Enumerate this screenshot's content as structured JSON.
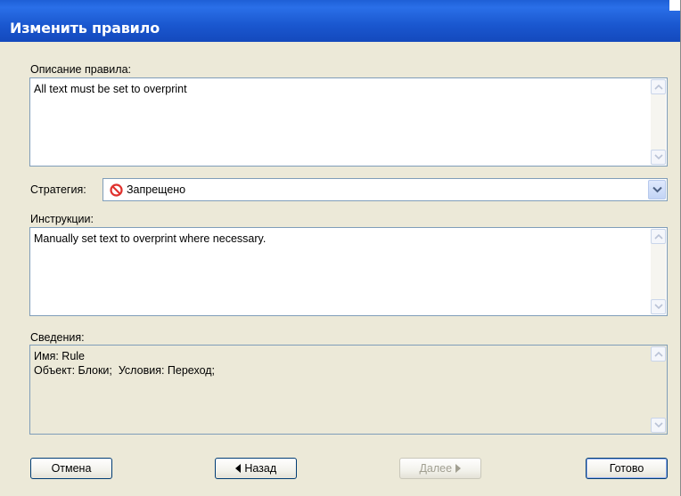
{
  "window": {
    "title": "Изменить правило"
  },
  "description": {
    "label": "Описание правила:",
    "value": "All text must be set to overprint"
  },
  "strategy": {
    "label": "Стратегия:",
    "selected": "Запрещено",
    "icon": "prohibited-icon",
    "icon_color": "#e0322e"
  },
  "instructions": {
    "label": "Инструкции:",
    "value": "Manually set text to overprint where necessary."
  },
  "info": {
    "label": "Сведения:",
    "line1": "Имя: Rule",
    "line2": "Объект: Блоки;  Условия: Переход;"
  },
  "buttons": {
    "cancel": "Отмена",
    "back": "Назад",
    "next": "Далее",
    "done": "Готово"
  }
}
